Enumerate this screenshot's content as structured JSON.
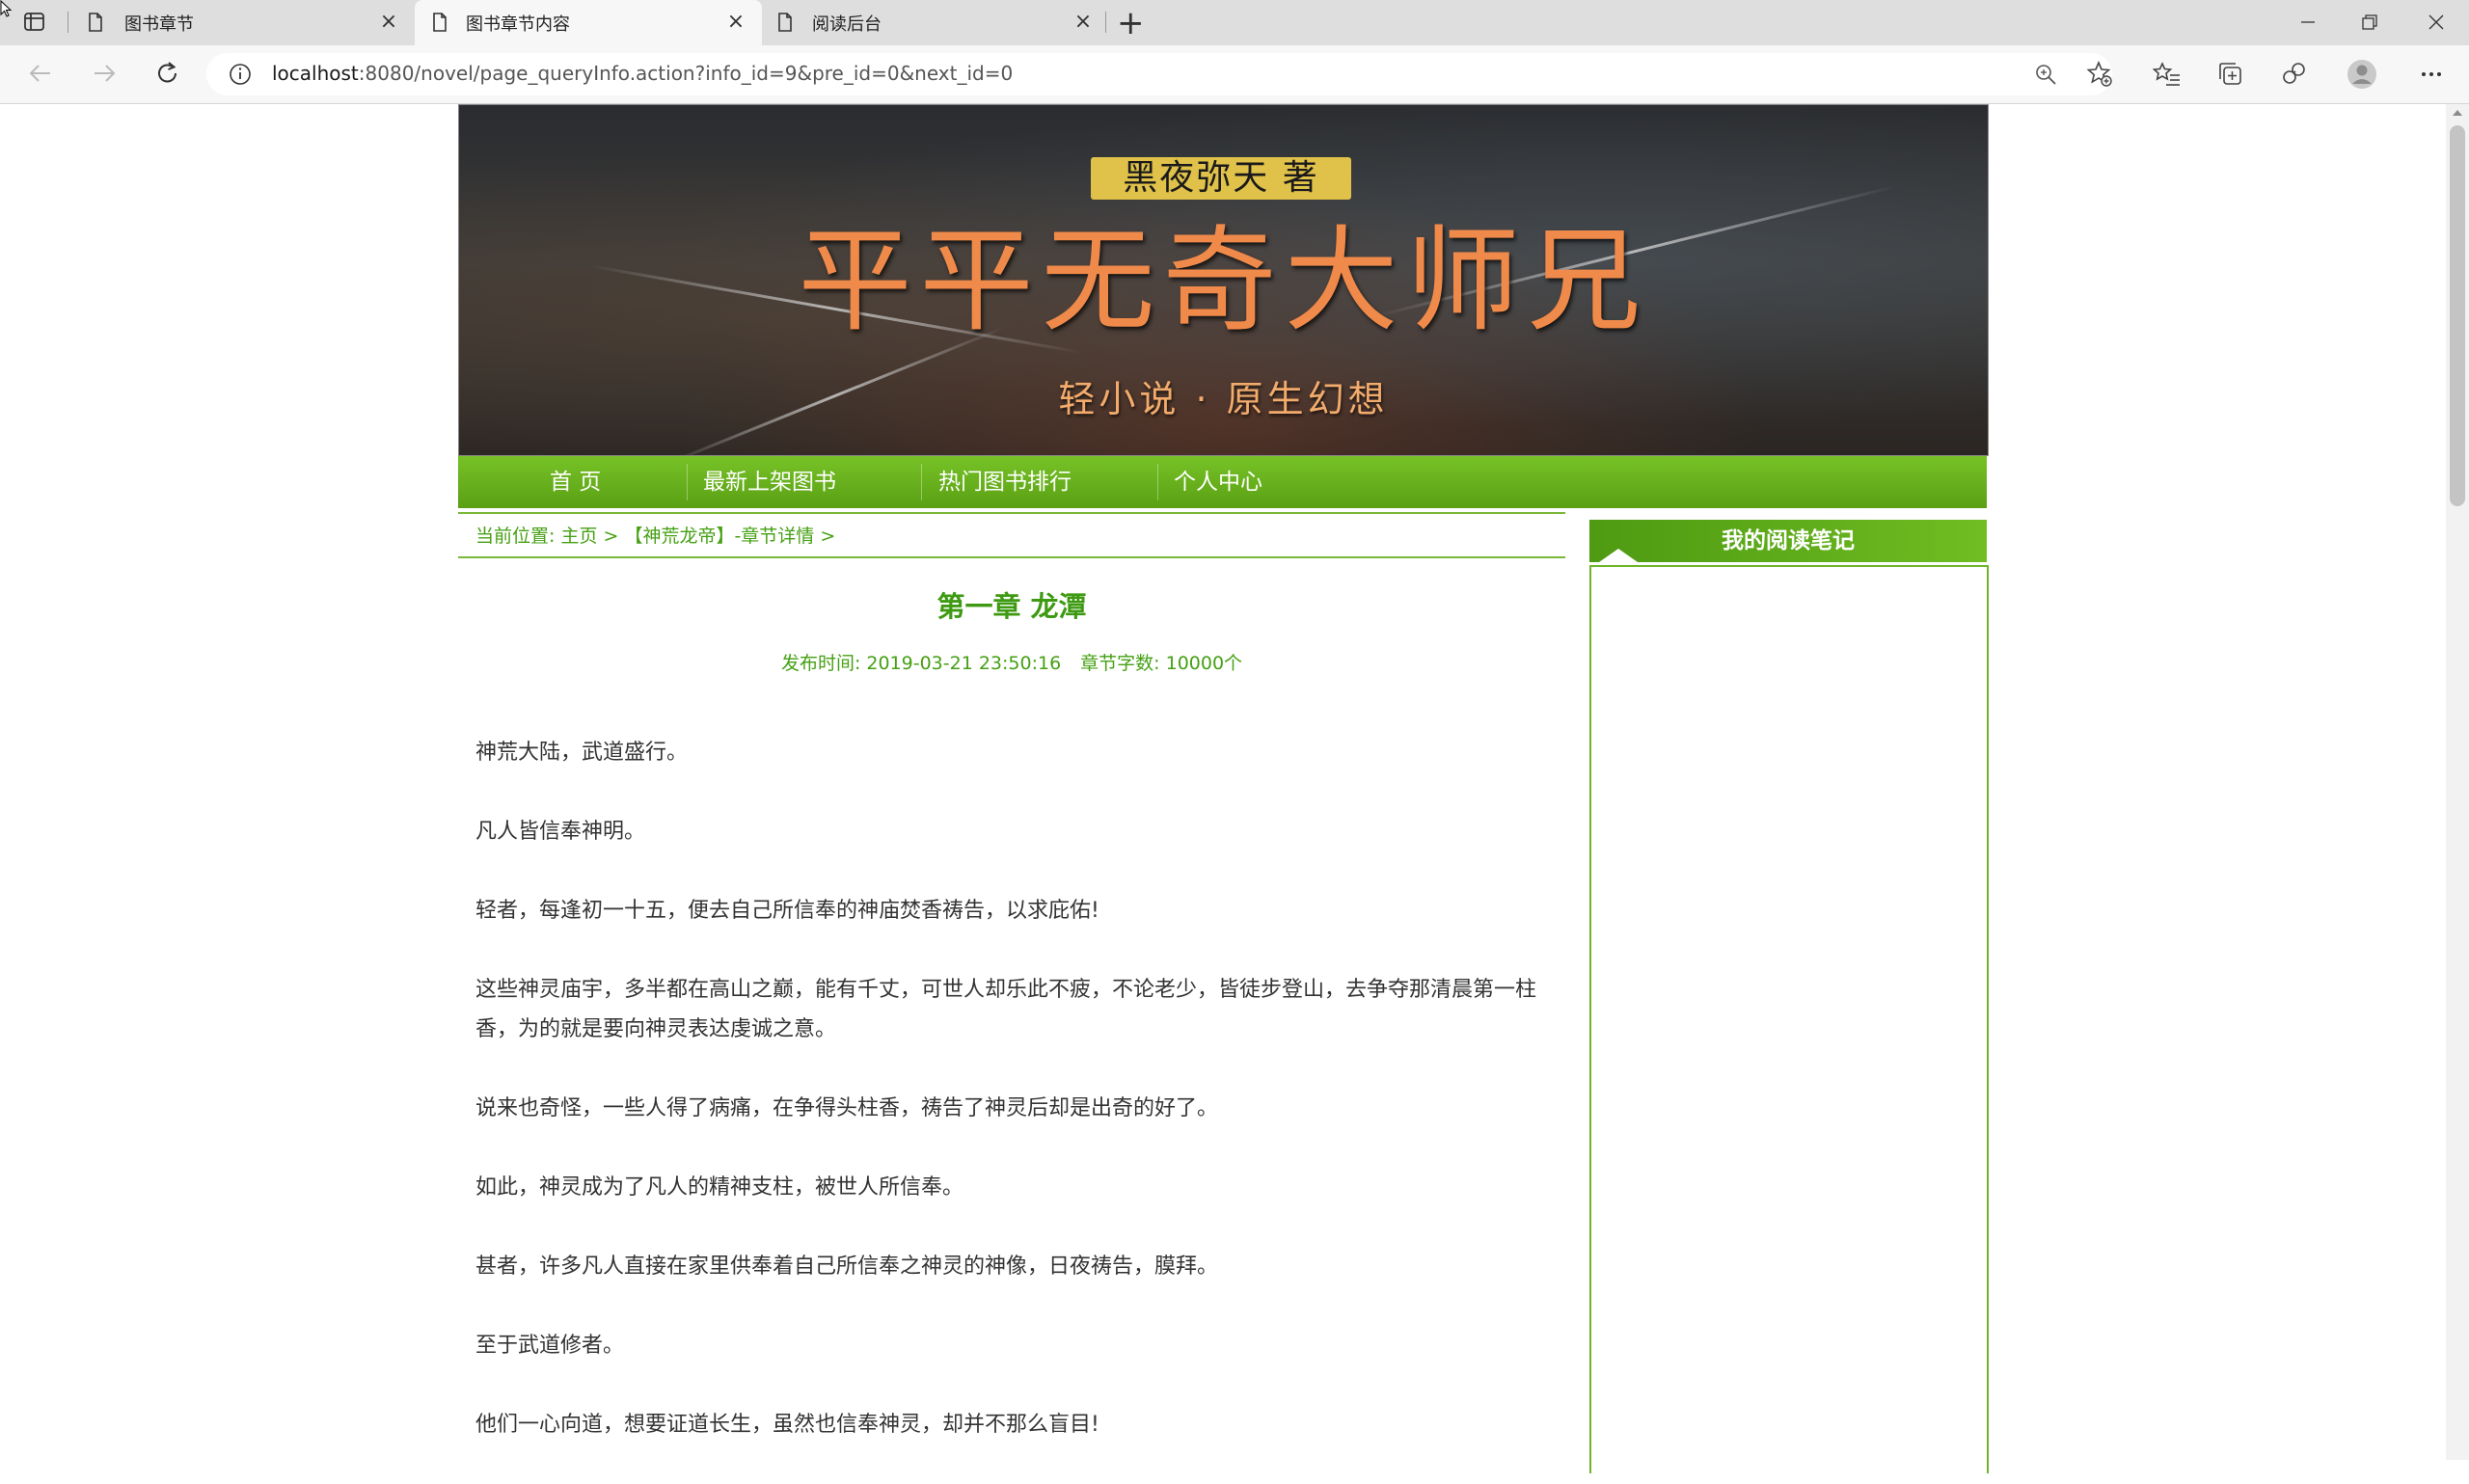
{
  "browser": {
    "tabs": [
      {
        "title": "图书章节",
        "active": false
      },
      {
        "title": "图书章节内容",
        "active": true
      },
      {
        "title": "阅读后台",
        "active": false
      }
    ],
    "new_tab_label": "+",
    "address": {
      "host": "localhost",
      "rest": ":8080/novel/page_queryInfo.action?info_id=9&pre_id=0&next_id=0"
    },
    "window_controls": [
      "minimize",
      "restore",
      "close"
    ]
  },
  "banner": {
    "author": "黑夜弥天 著",
    "title": "平平无奇大师兄",
    "subtitle": "轻小说 · 原生幻想"
  },
  "nav": {
    "items": [
      "首 页",
      "最新上架图书",
      "热门图书排行",
      "个人中心"
    ]
  },
  "breadcrumb": "当前位置: 主页 > 【神荒龙帝】-章节详情 >",
  "chapter": {
    "title": "第一章 龙潭",
    "publish_time": "发布时间:  2019-03-21 23:50:16",
    "word_count": "章节字数:  10000个",
    "paragraphs": [
      "神荒大陆，武道盛行。",
      "凡人皆信奉神明。",
      "轻者，每逢初一十五，便去自己所信奉的神庙焚香祷告，以求庇佑!",
      "这些神灵庙宇，多半都在高山之巅，能有千丈，可世人却乐此不疲，不论老少，皆徒步登山，去争夺那清晨第一柱香，为的就是要向神灵表达虔诚之意。",
      "说来也奇怪，一些人得了病痛，在争得头柱香，祷告了神灵后却是出奇的好了。",
      "如此，神灵成为了凡人的精神支柱，被世人所信奉。",
      "甚者，许多凡人直接在家里供奉着自己所信奉之神灵的神像，日夜祷告，膜拜。",
      "至于武道修者。",
      "他们一心向道，想要证道长生，虽然也信奉神灵，却并不那么盲目!"
    ]
  },
  "sidebar": {
    "title": "我的阅读笔记"
  },
  "colors": {
    "accent_green": "#5aa014",
    "text_green": "#45a013",
    "banner_title": "#f08a4a"
  }
}
